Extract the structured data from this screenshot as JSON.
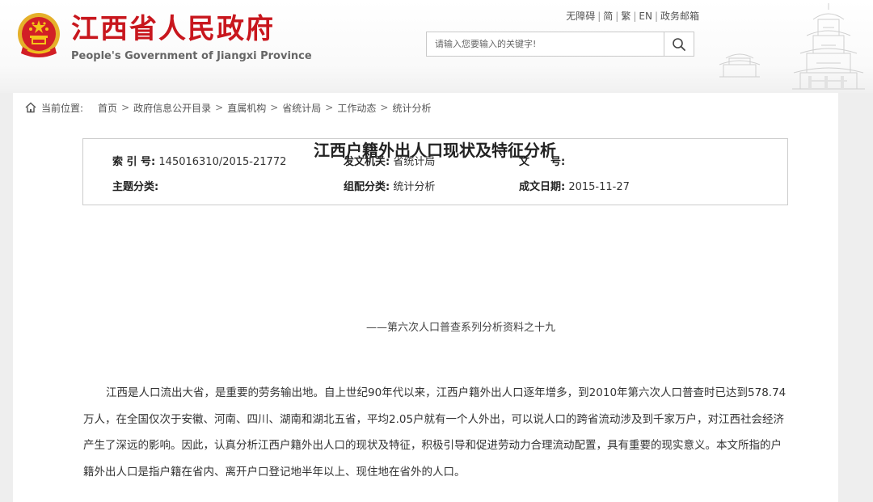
{
  "header": {
    "title": "江西省人民政府",
    "subtitle": "People's Government of Jiangxi Province",
    "toplinks": [
      "无障碍",
      "简",
      "繁",
      "EN",
      "政务邮箱"
    ],
    "search_placeholder": "请输入您要输入的关键字!",
    "brand_color": "#c8161d"
  },
  "breadcrumb": {
    "label": "当前位置:",
    "items": [
      "首页",
      "政府信息公开目录",
      "直属机构",
      "省统计局",
      "工作动态",
      "统计分析"
    ]
  },
  "meta": {
    "index_label": "索 引 号:",
    "index_value": "145016310/2015-21772",
    "issuer_label": "发文机关:",
    "issuer_value": "省统计局",
    "docno_label": "文　　号:",
    "docno_value": "",
    "topic_label": "主题分类:",
    "topic_value": "",
    "category_label": "组配分类:",
    "category_value": "统计分析",
    "date_label": "成文日期:",
    "date_value": "2015-11-27"
  },
  "article": {
    "title": "江西户籍外出人口现状及特征分析",
    "subtitle": "——第六次人口普查系列分析资料之十九",
    "paragraph": "江西是人口流出大省，是重要的劳务输出地。自上世纪90年代以来，江西户籍外出人口逐年增多，到2010年第六次人口普查时已达到578.74万人，在全国仅次于安徽、河南、四川、湖南和湖北五省，平均2.05户就有一个人外出，可以说人口的跨省流动涉及到千家万户，对江西社会经济产生了深远的影响。因此，认真分析江西户籍外出人口的现状及特征，积极引导和促进劳动力合理流动配置，具有重要的现实意义。本文所指的户籍外出人口是指户籍在省内、离开户口登记地半年以上、现住地在省外的人口。"
  },
  "icons": {
    "emblem": "national-emblem-icon",
    "search": "search-icon",
    "home": "home-icon",
    "skyline": "tengwang-pavilion-illustration"
  }
}
